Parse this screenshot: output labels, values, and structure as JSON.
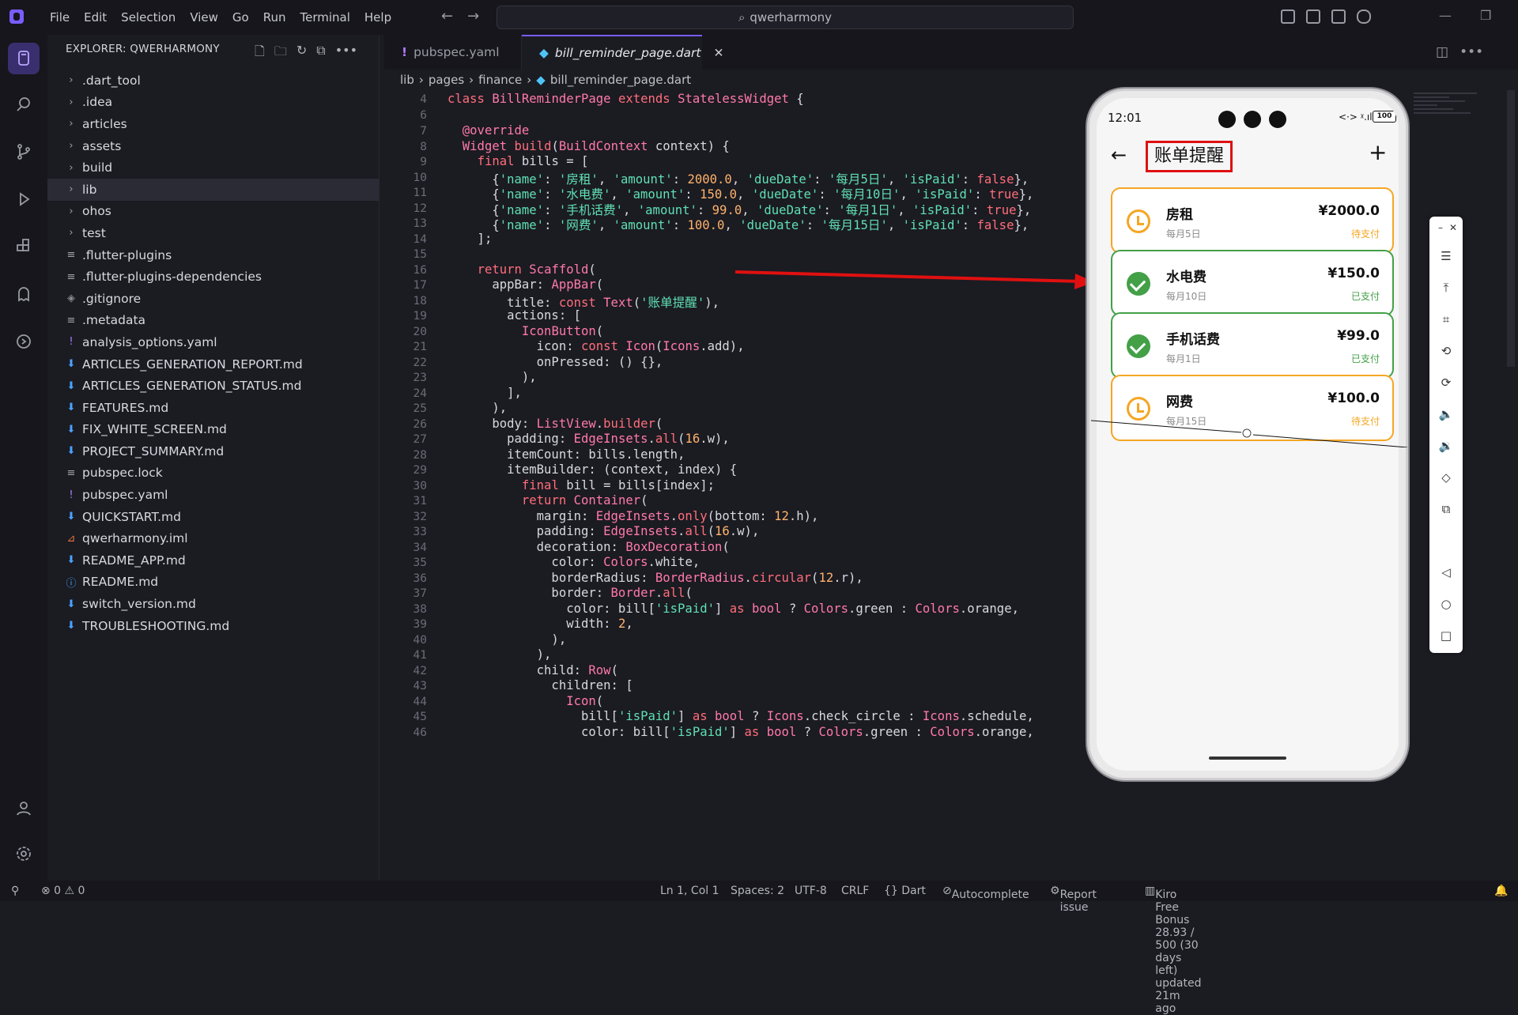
{
  "titlebar": {
    "menu": [
      "File",
      "Edit",
      "Selection",
      "View",
      "Go",
      "Run",
      "Terminal",
      "Help"
    ],
    "search": "qwerharmony"
  },
  "explorer": {
    "title": "EXPLORER: QWERHARMONY",
    "items": [
      {
        "label": ".dart_tool",
        "type": "folder"
      },
      {
        "label": ".idea",
        "type": "folder"
      },
      {
        "label": "articles",
        "type": "folder"
      },
      {
        "label": "assets",
        "type": "folder"
      },
      {
        "label": "build",
        "type": "folder"
      },
      {
        "label": "lib",
        "type": "folder",
        "selected": true
      },
      {
        "label": "ohos",
        "type": "folder"
      },
      {
        "label": "test",
        "type": "folder"
      },
      {
        "label": ".flutter-plugins",
        "type": "text"
      },
      {
        "label": ".flutter-plugins-dependencies",
        "type": "text"
      },
      {
        "label": ".gitignore",
        "type": "git"
      },
      {
        "label": ".metadata",
        "type": "text"
      },
      {
        "label": "analysis_options.yaml",
        "type": "yaml"
      },
      {
        "label": "ARTICLES_GENERATION_REPORT.md",
        "type": "md"
      },
      {
        "label": "ARTICLES_GENERATION_STATUS.md",
        "type": "md"
      },
      {
        "label": "FEATURES.md",
        "type": "md"
      },
      {
        "label": "FIX_WHITE_SCREEN.md",
        "type": "md"
      },
      {
        "label": "PROJECT_SUMMARY.md",
        "type": "md"
      },
      {
        "label": "pubspec.lock",
        "type": "text"
      },
      {
        "label": "pubspec.yaml",
        "type": "yaml"
      },
      {
        "label": "QUICKSTART.md",
        "type": "md"
      },
      {
        "label": "qwerharmony.iml",
        "type": "rss"
      },
      {
        "label": "README_APP.md",
        "type": "md"
      },
      {
        "label": "README.md",
        "type": "info"
      },
      {
        "label": "switch_version.md",
        "type": "md"
      },
      {
        "label": "TROUBLESHOOTING.md",
        "type": "md"
      }
    ]
  },
  "tabs": [
    {
      "label": "pubspec.yaml",
      "active": false
    },
    {
      "label": "bill_reminder_page.dart",
      "active": true
    }
  ],
  "breadcrumb": [
    "lib",
    "pages",
    "finance",
    "bill_reminder_page.dart"
  ],
  "editor": {
    "line_numbers": [
      4,
      6,
      7,
      8,
      9,
      10,
      11,
      12,
      13,
      14,
      15,
      16,
      17,
      18,
      19,
      20,
      21,
      22,
      23,
      24,
      25,
      26,
      27,
      28,
      29,
      30,
      31,
      32,
      33,
      34,
      35,
      36,
      37,
      38,
      39,
      40,
      41,
      42,
      43,
      44,
      45,
      46
    ]
  },
  "phone": {
    "time": "12:01",
    "battery": "100",
    "signal": "<·> ᵡ.ıll",
    "title": "账单提醒",
    "bills": [
      {
        "name": "房租",
        "due": "每月5日",
        "amount": "¥2000.0",
        "status": "待支付",
        "paid": false
      },
      {
        "name": "水电费",
        "due": "每月10日",
        "amount": "¥150.0",
        "status": "已支付",
        "paid": true
      },
      {
        "name": "手机话费",
        "due": "每月1日",
        "amount": "¥99.0",
        "status": "已支付",
        "paid": true
      },
      {
        "name": "网费",
        "due": "每月15日",
        "amount": "¥100.0",
        "status": "待支付",
        "paid": false
      }
    ]
  },
  "statusbar": {
    "problems": "⊗ 0 ⚠ 0",
    "position": "Ln 1, Col 1",
    "spaces": "Spaces: 2",
    "encoding": "UTF-8",
    "eol": "CRLF",
    "language": "{} Dart",
    "autocomplete": "Autocomplete",
    "report": "Report issue",
    "bonus": "Kiro Free Bonus 28.93 / 500 (30 days left) updated 21m ago"
  }
}
